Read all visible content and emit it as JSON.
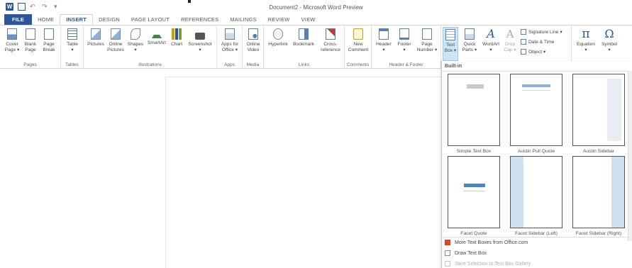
{
  "window": {
    "title": "Document2 - Microsoft Word Preview",
    "logo_letter": "W",
    "undo_glyph": "↶",
    "redo_glyph": "↷",
    "qat_more_glyph": "▾"
  },
  "tabs": [
    {
      "label": "FILE"
    },
    {
      "label": "HOME"
    },
    {
      "label": "INSERT"
    },
    {
      "label": "DESIGN"
    },
    {
      "label": "PAGE LAYOUT"
    },
    {
      "label": "REFERENCES"
    },
    {
      "label": "MAILINGS"
    },
    {
      "label": "REVIEW"
    },
    {
      "label": "VIEW"
    }
  ],
  "ribbon": {
    "pages": {
      "label": "Pages",
      "cover": "Cover\nPage ▾",
      "blank": "Blank\nPage",
      "break": "Page\nBreak"
    },
    "tables": {
      "label": "Tables",
      "table": "Table\n▾"
    },
    "illustrations": {
      "label": "Illustrations",
      "pictures": "Pictures",
      "online_pictures": "Online\nPictures",
      "shapes": "Shapes\n▾",
      "smartart": "SmartArt",
      "chart": "Chart",
      "screenshot": "Screenshot\n▾"
    },
    "apps": {
      "label": "Apps",
      "apps_for_office": "Apps for\nOffice ▾"
    },
    "media": {
      "label": "Media",
      "online_video": "Online\nVideo"
    },
    "links": {
      "label": "Links",
      "hyperlink": "Hyperlink",
      "bookmark": "Bookmark",
      "cross_reference": "Cross-\nreference"
    },
    "comments": {
      "label": "Comments",
      "new_comment": "New\nComment"
    },
    "header_footer": {
      "label": "Header & Footer",
      "header": "Header\n▾",
      "footer": "Footer\n▾",
      "page_number": "Page\nNumber ▾"
    },
    "text": {
      "text_box": "Text\nBox ▾",
      "quick_parts": "Quick\nParts ▾",
      "wordart": "WordArt\n▾",
      "drop_cap": "Drop\nCap ▾",
      "signature_line": "Signature Line ▾",
      "date_time": "Date & Time",
      "object": "Object ▾"
    },
    "symbols": {
      "equation": "Equation\n▾",
      "symbol": "Symbol\n▾",
      "pi_glyph": "π",
      "omega_glyph": "Ω"
    }
  },
  "gallery": {
    "heading": "Built-in",
    "items": [
      {
        "label": "Simple Text Box"
      },
      {
        "label": "Austin Pull Quote"
      },
      {
        "label": "Austin Sidebar"
      },
      {
        "label": "Facet Quote"
      },
      {
        "label": "Facet Sidebar (Left)"
      },
      {
        "label": "Facet Sidebar (Right)"
      }
    ],
    "menu": [
      {
        "label": "More Text Boxes from Office.com",
        "enabled": true
      },
      {
        "label": "Draw Text Box",
        "enabled": true
      },
      {
        "label": "Save Selection to Text Box Gallery",
        "enabled": false
      }
    ]
  },
  "colors": {
    "accent": "#2b579a",
    "highlight": "#cde6f7"
  }
}
